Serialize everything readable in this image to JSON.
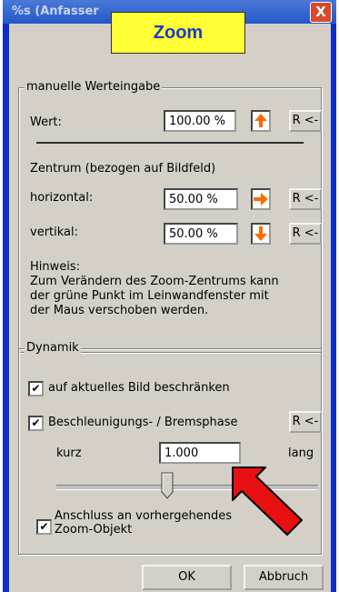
{
  "window": {
    "title": "%s (Anfasser",
    "close_glyph": "X",
    "zoom_label": "Zoom"
  },
  "manual": {
    "legend": "manuelle Werteingabe",
    "wert_label": "Wert:",
    "wert_value": "100.00 %",
    "reset_label": "R <-",
    "zentrum_title": "Zentrum (bezogen auf Bildfeld)",
    "horizontal_label": "horizontal:",
    "horizontal_value": "50.00 %",
    "vertikal_label": "vertikal:",
    "vertikal_value": "50.00 %",
    "hinweis_title": "Hinweis:",
    "hinweis_lines": [
      "Zum Verändern des Zoom-Zentrums kann",
      "der grüne Punkt  im Leinwandfenster mit",
      "der Maus verschoben werden."
    ]
  },
  "dynamik": {
    "legend": "Dynamik",
    "cb1_label": "auf aktuelles Bild beschränken",
    "cb1_checked": true,
    "cb2_label": "Beschleunigungs- / Bremsphase",
    "cb2_checked": true,
    "reset_label": "R <-",
    "kurz_label": "kurz",
    "lang_label": "lang",
    "slider_value": "1.000",
    "slider_level": 0.5,
    "cb3_label_line1": "Anschluss an vorhergehendes",
    "cb3_label_line2": "Zoom-Objekt",
    "cb3_checked": true
  },
  "buttons": {
    "ok": "OK",
    "abbruch": "Abbruch"
  },
  "icons": {
    "up_arrow": "arrow-up-icon",
    "right_arrow": "arrow-right-icon",
    "down_arrow": "arrow-down-icon",
    "check_glyph": "✔"
  },
  "colors": {
    "arrow_orange": "#ff6a00",
    "annotation_red": "#e81010",
    "highlight_yellow": "#ffff33"
  }
}
